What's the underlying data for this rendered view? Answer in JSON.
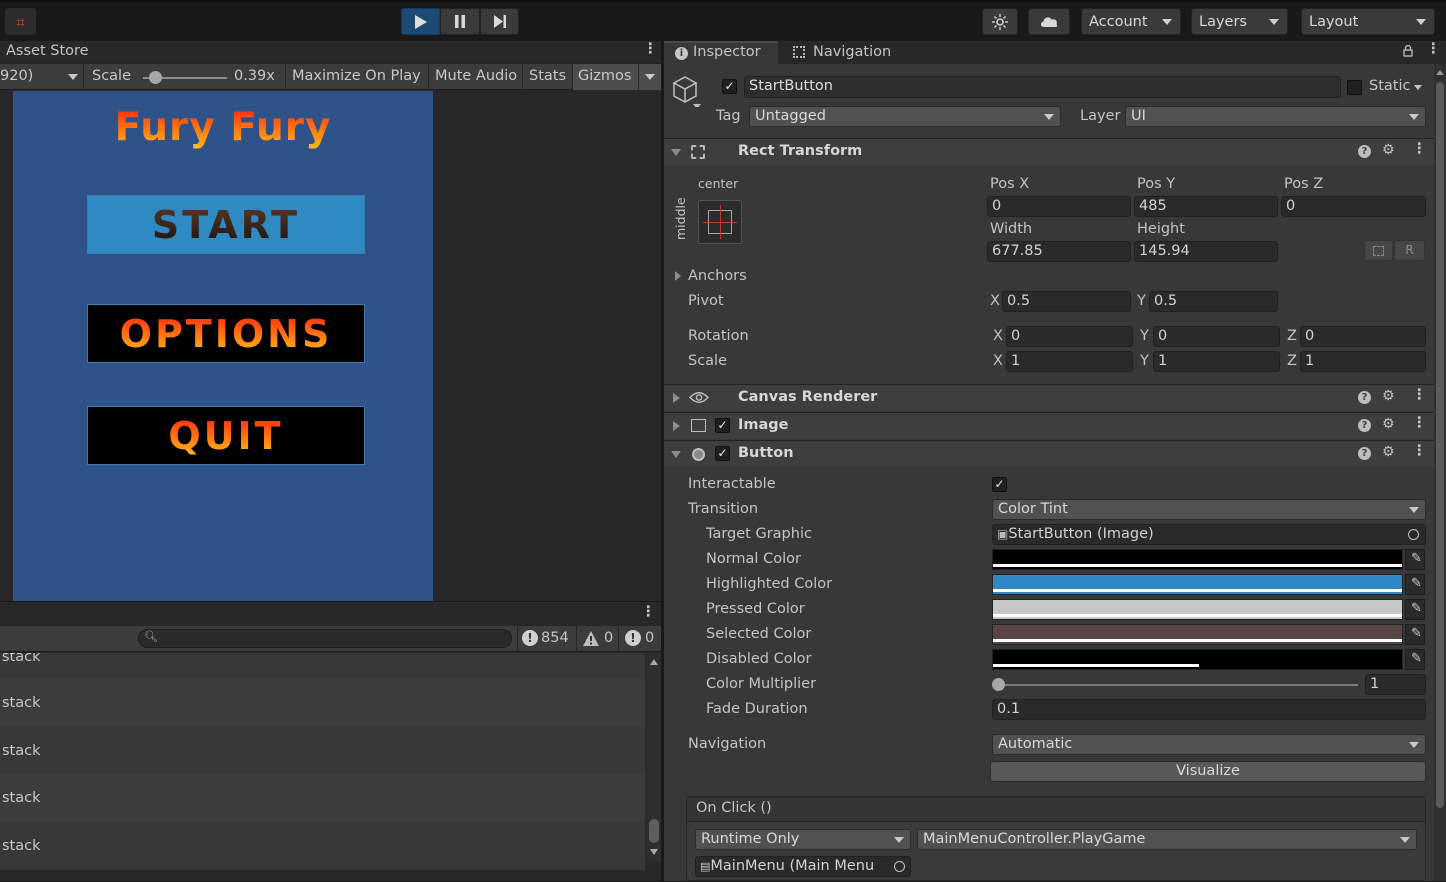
{
  "toolbar": {
    "account_label": "Account",
    "layers_label": "Layers",
    "layout_label": "Layout"
  },
  "game": {
    "tab_title": "Asset Store",
    "resolution_label": "920)",
    "scale_label": "Scale",
    "scale_value": "0.39x",
    "scale_fraction": 0.1,
    "maximize_label": "Maximize On Play",
    "mute_label": "Mute Audio",
    "stats_label": "Stats",
    "gizmos_label": "Gizmos",
    "game_title": "Fury Fury",
    "buttons": [
      "START",
      "OPTIONS",
      "QUIT"
    ]
  },
  "console": {
    "log_count": "854",
    "warn_count": "0",
    "error_count": "0",
    "rows": [
      "stack",
      "stack",
      "stack",
      "stack",
      "stack"
    ]
  },
  "inspector": {
    "tab_inspector": "Inspector",
    "tab_navigation": "Navigation",
    "object_name": "StartButton",
    "static_label": "Static",
    "tag_label": "Tag",
    "tag_value": "Untagged",
    "layer_label": "Layer",
    "layer_value": "UI",
    "rect_transform": {
      "title": "Rect Transform",
      "anchor_preset_h": "center",
      "anchor_preset_v": "middle",
      "pos_x_label": "Pos X",
      "pos_x": "0",
      "pos_y_label": "Pos Y",
      "pos_y": "485",
      "pos_z_label": "Pos Z",
      "pos_z": "0",
      "width_label": "Width",
      "width": "677.85",
      "height_label": "Height",
      "height": "145.94",
      "anchors_label": "Anchors",
      "pivot_label": "Pivot",
      "pivot_x": "0.5",
      "pivot_y": "0.5",
      "rotation_label": "Rotation",
      "rot_x": "0",
      "rot_y": "0",
      "rot_z": "0",
      "scale_label": "Scale",
      "scale_x": "1",
      "scale_y": "1",
      "scale_z": "1",
      "x": "X",
      "y": "Y",
      "z": "Z",
      "r_button": "R"
    },
    "canvas_renderer": "Canvas Renderer",
    "image": "Image",
    "button": {
      "title": "Button",
      "interactable_label": "Interactable",
      "transition_label": "Transition",
      "transition_value": "Color Tint",
      "target_graphic_label": "Target Graphic",
      "target_graphic_value": "StartButton (Image)",
      "normal_label": "Normal Color",
      "highlighted_label": "Highlighted Color",
      "pressed_label": "Pressed Color",
      "selected_label": "Selected Color",
      "disabled_label": "Disabled Color",
      "multiplier_label": "Color Multiplier",
      "multiplier_value": "1",
      "multiplier_fraction": 0.0,
      "fade_label": "Fade Duration",
      "fade_value": "0.1",
      "navigation_label": "Navigation",
      "navigation_value": "Automatic",
      "visualize_label": "Visualize",
      "onclick_label": "On Click ()",
      "runtime_value": "Runtime Only",
      "function_value": "MainMenuController.PlayGame",
      "object_value": "MainMenu (Main Menu"
    }
  },
  "colors": {
    "normal": "#000000",
    "highlighted": "#2f88c5",
    "pressed": "#c8c8c8",
    "selected": "#5a4545",
    "disabled": "#000000",
    "play_active": "#1d4a73"
  }
}
